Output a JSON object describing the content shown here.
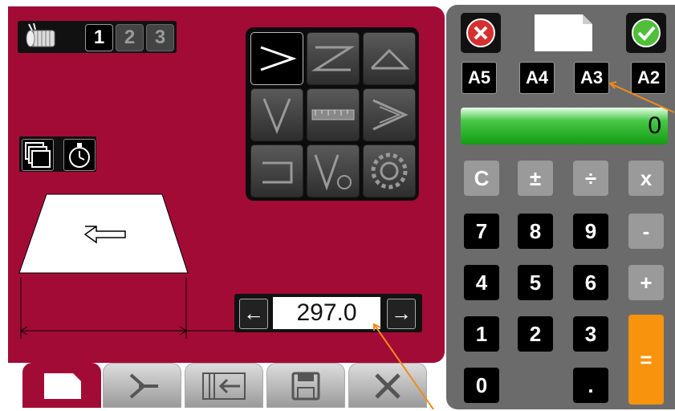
{
  "passes": {
    "items": [
      "1",
      "2",
      "3"
    ],
    "active": "1"
  },
  "fold_grid": {
    "selected": "fold-type-1"
  },
  "value_field": {
    "value": "297.0",
    "left_arrow": "←",
    "right_arrow": "→"
  },
  "paper_sizes": [
    "A5",
    "A4",
    "A3",
    "A2"
  ],
  "display": {
    "value": "0"
  },
  "keypad": {
    "clear": "C",
    "plusminus": "±",
    "divide": "÷",
    "multiply": "x",
    "seven": "7",
    "eight": "8",
    "nine": "9",
    "minus": "-",
    "four": "4",
    "five": "5",
    "six": "6",
    "plus": "+",
    "one": "1",
    "two": "2",
    "three": "3",
    "equals": "=",
    "zero": "0",
    "dot": "."
  },
  "colors": {
    "left_panel": "#a30b37",
    "right_panel": "#6b6b6b",
    "display_green": "#139c13",
    "orange": "#f7930d",
    "annotation": "#f08a1c"
  },
  "icons": [
    "roller-icon",
    "stack-icon",
    "stopwatch-icon",
    "left-arrow-icon",
    "cancel-icon",
    "confirm-icon",
    "paper-icon",
    "fold-icon",
    "feed-icon",
    "save-icon",
    "tools-icon"
  ]
}
